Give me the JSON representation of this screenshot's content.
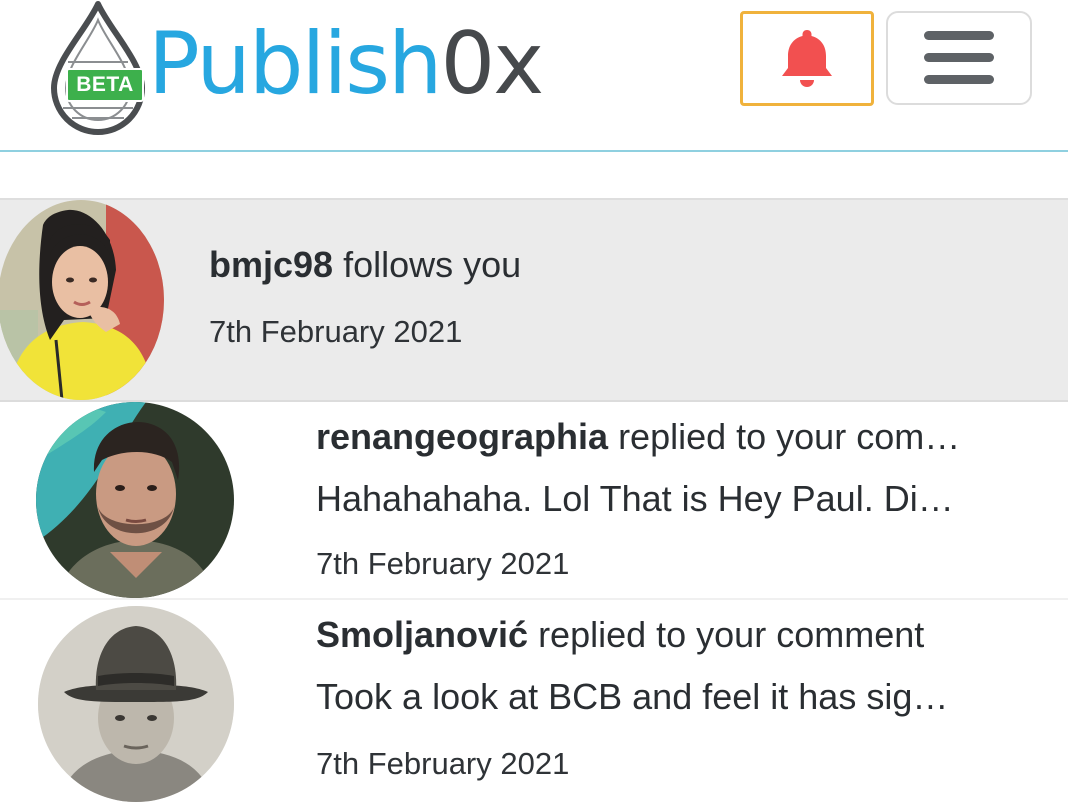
{
  "header": {
    "logo": {
      "badge": "BETA",
      "word_part1": "Publish",
      "word_part2": "0x"
    },
    "bell_icon": "bell-icon",
    "menu_icon": "hamburger-menu-icon",
    "bell_color": "#f25050",
    "accent_border": "#f0b23c"
  },
  "notifications": [
    {
      "user": "bmjc98",
      "action": " follows you",
      "preview": "",
      "date": "7th February 2021",
      "highlighted": true
    },
    {
      "user": "renangeographia",
      "action": " replied to your com…",
      "preview": "Hahahahaha. Lol That is Hey Paul. Di…",
      "date": "7th February 2021",
      "highlighted": false
    },
    {
      "user": "Smoljanović",
      "action": " replied to your comment",
      "preview": "Took a look at BCB and feel it has sig…",
      "date": "7th February 2021",
      "highlighted": false
    }
  ]
}
